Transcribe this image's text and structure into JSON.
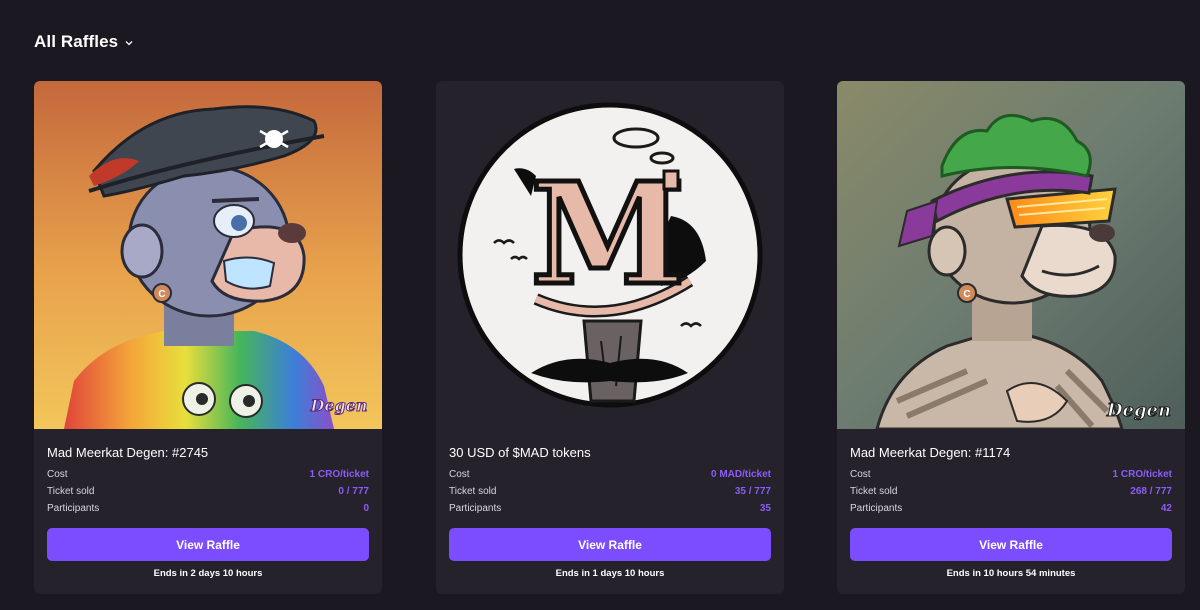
{
  "header": {
    "title": "All Raffles",
    "chevron_icon": "chevron-down-icon"
  },
  "colors": {
    "background": "#1b1822",
    "card": "#25222c",
    "accent": "#7c4dff",
    "value": "#8b5cf6"
  },
  "cards": [
    {
      "title": "Mad Meerkat Degen: #2745",
      "image": "pirate-meerkat-nft",
      "watermark": "Degen",
      "rows": [
        {
          "label": "Cost",
          "value": "1 CRO/ticket"
        },
        {
          "label": "Ticket sold",
          "value": "0 / 777"
        },
        {
          "label": "Participants",
          "value": "0"
        }
      ],
      "button": "View Raffle",
      "ends": "Ends in 2 days 10 hours"
    },
    {
      "title": "30 USD of $MAD tokens",
      "image": "mad-token-logo",
      "logo_letter": "M",
      "rows": [
        {
          "label": "Cost",
          "value": "0 MAD/ticket"
        },
        {
          "label": "Ticket sold",
          "value": "35 / 777"
        },
        {
          "label": "Participants",
          "value": "35"
        }
      ],
      "button": "View Raffle",
      "ends": "Ends in 1 days 10 hours"
    },
    {
      "title": "Mad Meerkat Degen: #1174",
      "image": "bandana-meerkat-nft",
      "watermark": "Degen",
      "rows": [
        {
          "label": "Cost",
          "value": "1 CRO/ticket"
        },
        {
          "label": "Ticket sold",
          "value": "268 / 777"
        },
        {
          "label": "Participants",
          "value": "42"
        }
      ],
      "button": "View Raffle",
      "ends": "Ends in 10 hours 54 minutes"
    }
  ]
}
